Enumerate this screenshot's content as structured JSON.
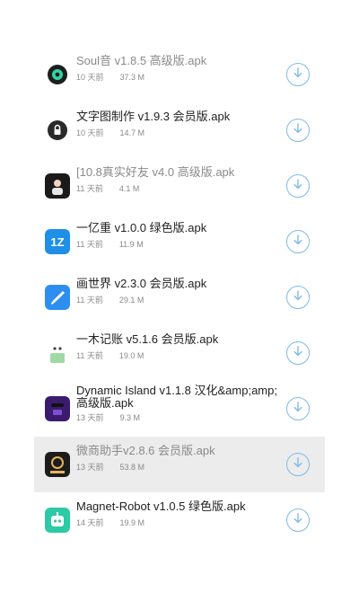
{
  "download_list": {
    "items": [
      {
        "title": "Soul音 v1.8.5 高级版.apk",
        "time": "10 天前",
        "size": "37.3 M",
        "icon": "soul-app-icon",
        "dim": true
      },
      {
        "title": "文字图制作 v1.9.3 会员版.apk",
        "time": "10 天前",
        "size": "14.7 M",
        "icon": "text-image-app-icon"
      },
      {
        "title": "[10.8真实好友 v4.0 高级版.apk",
        "time": "11 天前",
        "size": "4.1 M",
        "icon": "friends-app-icon",
        "dim": true
      },
      {
        "title": "一亿重 v1.0.0 绿色版.apk",
        "time": "11 天前",
        "size": "11.9 M",
        "icon": "yiyizhong-app-icon"
      },
      {
        "title": "画世界 v2.3.0 会员版.apk",
        "time": "11 天前",
        "size": "29.1 M",
        "icon": "paint-world-app-icon"
      },
      {
        "title": "一木记账 v5.1.6 会员版.apk",
        "time": "11 天前",
        "size": "19.0 M",
        "icon": "yimu-ledger-app-icon"
      },
      {
        "title": "Dynamic Island v1.1.8 汉化&amp;amp;高级版.apk",
        "time": "13 天前",
        "size": "9.3 M",
        "icon": "dynamic-island-app-icon",
        "two_line": true
      },
      {
        "title": "微商助手v2.8.6 会员版.apk",
        "time": "13 天前",
        "size": "53.8 M",
        "icon": "wechat-business-app-icon",
        "highlight": true,
        "dim": true
      },
      {
        "title": "Magnet-Robot v1.0.5 绿色版.apk",
        "time": "14 天前",
        "size": "19.9 M",
        "icon": "magnet-robot-app-icon"
      }
    ]
  },
  "colors": {
    "accent": "#7fbbe6",
    "highlight_row": "#ececec",
    "meta_text": "#8a8a8a"
  }
}
